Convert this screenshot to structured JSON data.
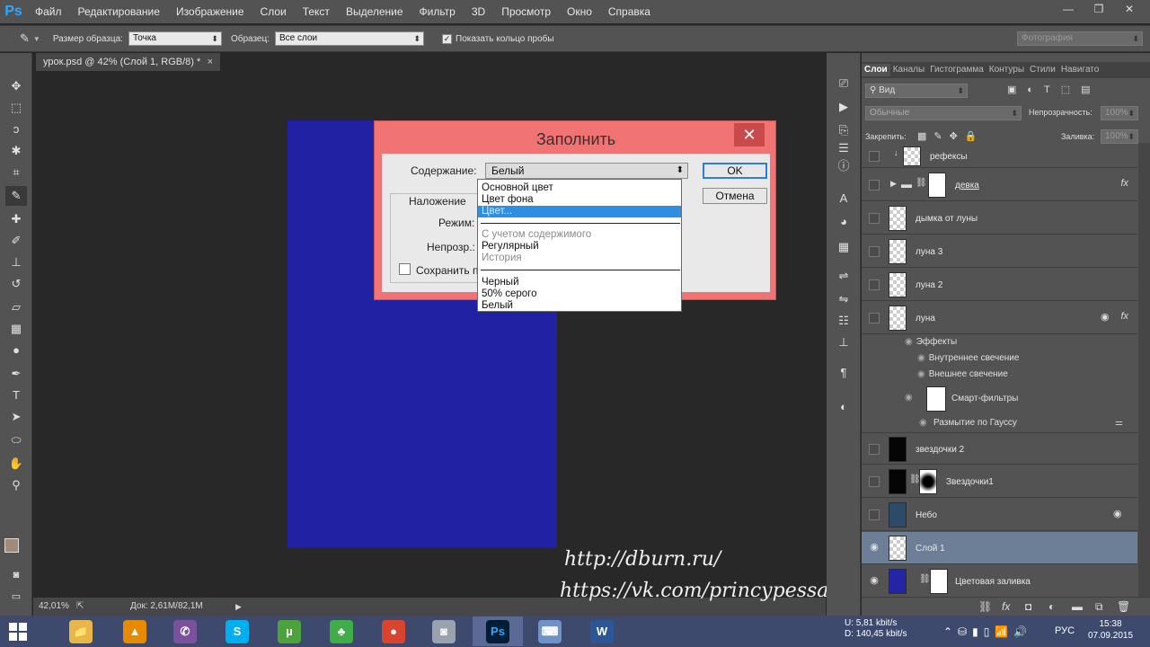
{
  "app": {
    "logo": "Ps"
  },
  "menu": [
    "Файл",
    "Редактирование",
    "Изображение",
    "Слои",
    "Текст",
    "Выделение",
    "Фильтр",
    "3D",
    "Просмотр",
    "Окно",
    "Справка"
  ],
  "window_controls": {
    "minimize": "—",
    "restore": "❐",
    "close": "✕"
  },
  "options_bar": {
    "sample_size_label": "Размер образца:",
    "sample_size_value": "Точка",
    "sample_label": "Образец:",
    "sample_value": "Все слои",
    "show_ring_label": "Показать кольцо пробы",
    "workspace_value": "Фотография"
  },
  "document_tab": {
    "title": "урок.psd @ 42% (Слой 1, RGB/8) *",
    "close": "×"
  },
  "status_bar": {
    "zoom": "42,01%",
    "doc_size": "Док: 2,61M/82,1M"
  },
  "dialog": {
    "title": "Заполнить",
    "close": "✕",
    "content_label": "Содержание:",
    "content_value": "Белый",
    "blending_label": "Наложение",
    "mode_label": "Режим:",
    "opacity_label": "Непрозр.:",
    "preserve_label": "Сохранить пр",
    "ok": "OK",
    "cancel": "Отмена"
  },
  "dropdown": {
    "group1": [
      "Основной цвет",
      "Цвет фона",
      "Цвет..."
    ],
    "group2": [
      "С учетом содержимого",
      "Регулярный",
      "История"
    ],
    "group3": [
      "Черный",
      "50% серого",
      "Белый"
    ],
    "highlighted": "Цвет..."
  },
  "layers_panel": {
    "tabs": [
      "Слои",
      "Каналы",
      "Гистограмма",
      "Контуры",
      "Стили",
      "Навигато"
    ],
    "filter_label": "Вид",
    "blend_mode": "Обычные",
    "opacity_label": "Непрозрачность:",
    "opacity_value": "100%",
    "lock_label": "Закрепить:",
    "fill_label": "Заливка:",
    "fill_value": "100%",
    "layers": [
      {
        "name": "рефексы"
      },
      {
        "name": "девка"
      },
      {
        "name": "дымка от луны"
      },
      {
        "name": "луна 3"
      },
      {
        "name": "луна 2"
      },
      {
        "name": "луна"
      },
      {
        "name": "звездочки 2"
      },
      {
        "name": "Звездочки1"
      },
      {
        "name": "Небо"
      },
      {
        "name": "Слой 1"
      },
      {
        "name": "Цветовая заливка"
      }
    ],
    "effects": {
      "effects_label": "Эффекты",
      "inner_glow": "Внутреннее свечение",
      "outer_glow": "Внешнее свечение",
      "smart_filters": "Смарт-фильтры",
      "gaussian_blur": "Размытие по Гауссу"
    },
    "fx": "fx"
  },
  "watermark": {
    "line1": "http://dburn.ru/",
    "line2": "https://vk.com/princypessa"
  },
  "taskbar": {
    "apps": [
      {
        "name": "explorer",
        "label": "📁",
        "color": "#e8b74a"
      },
      {
        "name": "avast",
        "label": "▲",
        "color": "#e68a00"
      },
      {
        "name": "viber",
        "label": "✆",
        "color": "#7b519d"
      },
      {
        "name": "skype",
        "label": "S",
        "color": "#00aff0"
      },
      {
        "name": "utorrent",
        "label": "µ",
        "color": "#4da33b"
      },
      {
        "name": "clover",
        "label": "♣",
        "color": "#3fae49"
      },
      {
        "name": "chrome",
        "label": "●",
        "color": "#d9442f"
      },
      {
        "name": "audio",
        "label": "◙",
        "color": "#9aa3ad"
      },
      {
        "name": "photoshop",
        "label": "Ps",
        "color": "#001e36"
      },
      {
        "name": "keyboard",
        "label": "⌨",
        "color": "#6f93c6"
      },
      {
        "name": "word",
        "label": "W",
        "color": "#2b5797"
      }
    ],
    "net_up": "U:   5,81 kbit/s",
    "net_down": "D: 140,45 kbit/s",
    "lang": "РУС",
    "time": "15:38",
    "date": "07.09.2015"
  }
}
